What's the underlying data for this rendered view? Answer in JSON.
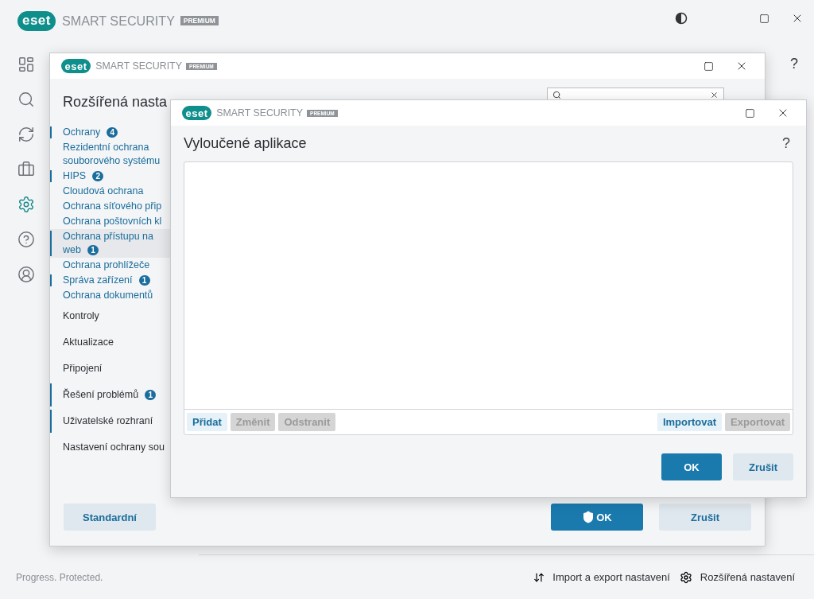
{
  "app": {
    "logo": "eset",
    "product": "SMART SECURITY",
    "edition": "PREMIUM",
    "help": "?",
    "nav": [
      {
        "selected": false
      },
      {
        "selected": false
      },
      {
        "selected": false
      },
      {
        "selected": false
      },
      {
        "selected": true
      },
      {
        "selected": false
      },
      {
        "selected": false
      }
    ],
    "status_bar": {
      "slogan": "Progress. Protected.",
      "links": [
        "Import a export nastavení",
        "Rozšířená nastavení"
      ]
    }
  },
  "settings_dialog": {
    "logo": "eset",
    "product": "SMART SECURITY",
    "edition": "PREMIUM",
    "title": "Rozšířená nasta",
    "search_field": {
      "clear_button": true
    },
    "sections": [
      {
        "label": "Ochrany",
        "badge": "4",
        "changed": true,
        "selected": false,
        "expanded": true,
        "children": [
          {
            "label": "Rezidentní ochrana souborového systému",
            "changed": false,
            "selected": false
          },
          {
            "label": "HIPS",
            "badge": "2",
            "changed": true,
            "selected": false
          },
          {
            "label": "Cloudová ochrana",
            "changed": false,
            "selected": false
          },
          {
            "label": "Ochrana síťového přip",
            "changed": false,
            "selected": false
          },
          {
            "label": "Ochrana poštovních kl",
            "changed": false,
            "selected": false
          },
          {
            "label": "Ochrana přístupu na web",
            "badge": "1",
            "changed": true,
            "selected": true
          },
          {
            "label": "Ochrana prohlížeče",
            "changed": false,
            "selected": false
          },
          {
            "label": "Správa zařízení",
            "badge": "1",
            "changed": true,
            "selected": false
          },
          {
            "label": "Ochrana dokumentů",
            "changed": false,
            "selected": false
          }
        ]
      },
      {
        "label": "Kontroly",
        "changed": false,
        "selected": false,
        "expanded": false
      },
      {
        "label": "Aktualizace",
        "changed": false,
        "selected": false,
        "expanded": false
      },
      {
        "label": "Připojení",
        "changed": false,
        "selected": false,
        "expanded": false
      },
      {
        "label": "Řešení problémů",
        "badge": "1",
        "changed": true,
        "selected": false,
        "expanded": false
      },
      {
        "label": "Uživatelské rozhraní",
        "changed": true,
        "selected": false,
        "expanded": false
      },
      {
        "label": "Nastavení ochrany sou",
        "changed": false,
        "selected": false,
        "expanded": false
      }
    ],
    "buttons": [
      {
        "label": "Standardní",
        "kind": "secondary"
      },
      {
        "label": "OK",
        "kind": "primary-shield"
      },
      {
        "label": "Zrušit",
        "kind": "secondary"
      }
    ]
  },
  "exclusions_dialog": {
    "logo": "eset",
    "product": "SMART SECURITY",
    "edition": "PREMIUM",
    "title": "Vyloučené aplikace",
    "help": "?",
    "toolbar_left": [
      {
        "label": "Přidat",
        "disabled": false
      },
      {
        "label": "Změnit",
        "disabled": true
      },
      {
        "label": "Odstranit",
        "disabled": true
      }
    ],
    "toolbar_right": [
      {
        "label": "Importovat",
        "disabled": false
      },
      {
        "label": "Exportovat",
        "disabled": true
      }
    ],
    "buttons": [
      {
        "label": "OK",
        "kind": "primary"
      },
      {
        "label": "Zrušit",
        "kind": "secondary"
      }
    ]
  }
}
